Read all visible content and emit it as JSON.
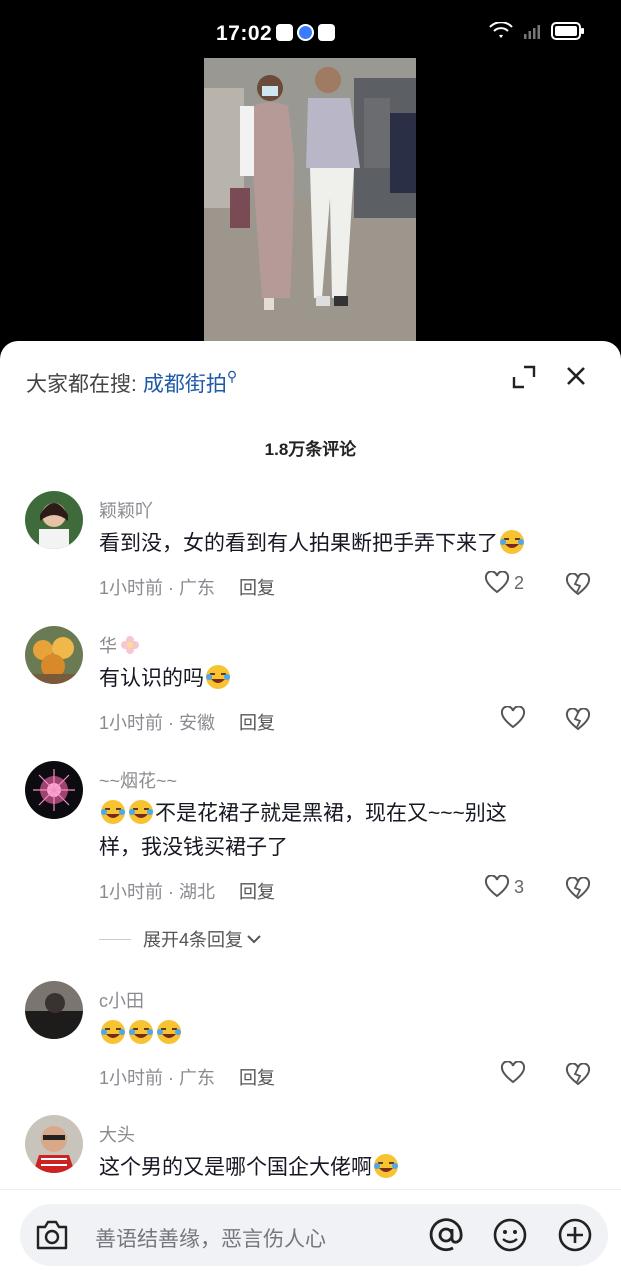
{
  "status_bar": {
    "time": "17:02"
  },
  "panel": {
    "search_prefix": "大家都在搜:",
    "search_keyword": "成都街拍",
    "comment_count_title": "1.8万条评论"
  },
  "comments": [
    {
      "name": "颖颖吖",
      "text": "看到没，女的看到有人拍果断把手弄下来了",
      "time": "1小时前 · 广东",
      "reply": "回复",
      "likes": "2"
    },
    {
      "name": "华",
      "text": "有认识的吗",
      "time": "1小时前 · 安徽",
      "reply": "回复",
      "likes": ""
    },
    {
      "name": "~~烟花~~",
      "text_line1": "不是花裙子就是黑裙，现在又~~~别这",
      "text_line2": "样，我没钱买裙子了",
      "time": "1小时前 · 湖北",
      "reply": "回复",
      "likes": "3",
      "expand_replies": "展开4条回复"
    },
    {
      "name": "c小田",
      "text": "",
      "time": "1小时前 · 广东",
      "reply": "回复",
      "likes": ""
    },
    {
      "name": "大头",
      "text": "这个男的又是哪个国企大佬啊"
    }
  ],
  "input_bar": {
    "placeholder": "善语结善缘，恶言伤人心"
  },
  "colors": {
    "keyword": "#1e5aa8",
    "muted_text": "#8a8b91",
    "background": "#ffffff"
  }
}
